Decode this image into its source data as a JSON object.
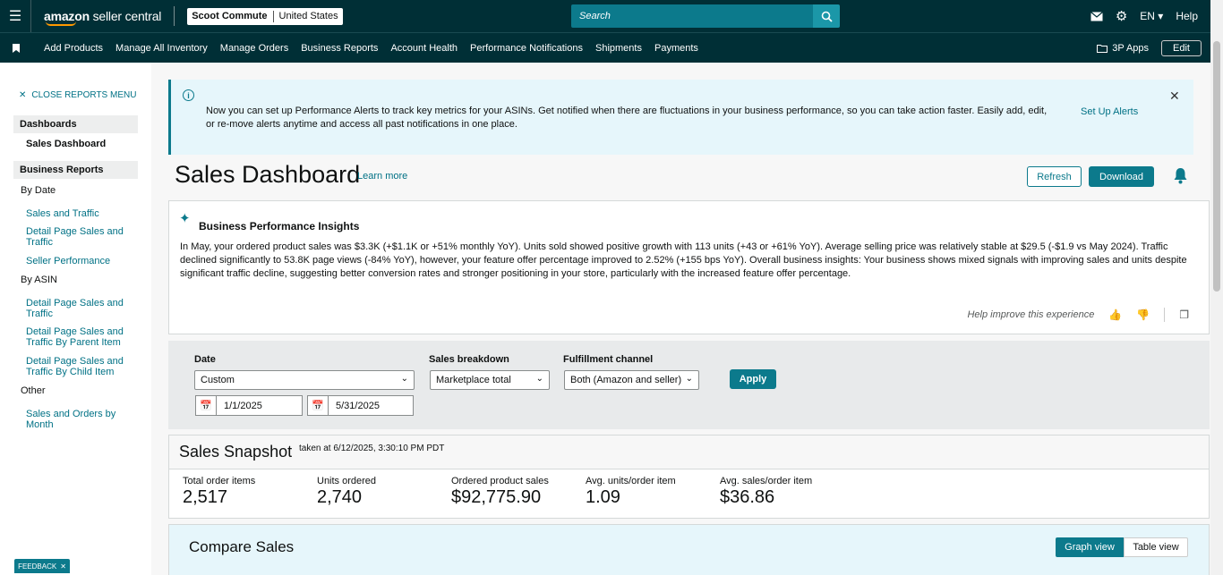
{
  "topbar": {
    "logo_bold": "amazon",
    "logo_light": " seller central",
    "store_name": "Scoot Commute",
    "marketplace": "United States",
    "search_placeholder": "Search",
    "language": "EN",
    "help": "Help"
  },
  "navbar": {
    "items": [
      "Add Products",
      "Manage All Inventory",
      "Manage Orders",
      "Business Reports",
      "Account Health",
      "Performance Notifications",
      "Shipments",
      "Payments"
    ],
    "apps_label": "3P Apps",
    "edit_label": "Edit"
  },
  "sidebar": {
    "close_menu": "CLOSE REPORTS MENU",
    "section_dashboards": "Dashboards",
    "sales_dashboard": "Sales Dashboard",
    "section_business_reports": "Business Reports",
    "by_date": "By Date",
    "by_date_links": [
      "Sales and Traffic",
      "Detail Page Sales and Traffic",
      "Seller Performance"
    ],
    "by_asin": "By ASIN",
    "by_asin_links": [
      "Detail Page Sales and Traffic",
      "Detail Page Sales and Traffic By Parent Item",
      "Detail Page Sales and Traffic By Child Item"
    ],
    "other": "Other",
    "other_links": [
      "Sales and Orders by Month"
    ]
  },
  "alert": {
    "text": "Now you can set up Performance Alerts to track key metrics for your ASINs. Get notified when there are fluctuations in your business performance, so you can take action faster. Easily add, edit, or re-move alerts anytime and access all past notifications in one place.",
    "link": "Set Up Alerts"
  },
  "page": {
    "title": "Sales Dashboard",
    "learn_more": "Learn more",
    "refresh": "Refresh",
    "download": "Download"
  },
  "insights": {
    "title": "Business Performance Insights",
    "body": "In May, your ordered product sales was $3.3K (+$1.1K or +51% monthly YoY). Units sold showed positive growth with 113 units (+43 or +61% YoY). Average selling price was relatively stable at $29.5 (-$1.9 vs May 2024). Traffic declined significantly to 53.8K page views (-84% YoY), however, your feature offer percentage improved to 2.52% (+155 bps YoY). Overall business insights: Your business shows mixed signals with improving sales and units despite significant traffic decline, suggesting better conversion rates and stronger positioning in your store, particularly with the increased feature offer percentage.",
    "feedback_prompt": "Help improve this experience"
  },
  "filters": {
    "date_label": "Date",
    "date_value": "Custom",
    "start_date": "1/1/2025",
    "end_date": "5/31/2025",
    "breakdown_label": "Sales breakdown",
    "breakdown_value": "Marketplace total",
    "channel_label": "Fulfillment channel",
    "channel_value": "Both (Amazon and seller)",
    "apply": "Apply"
  },
  "snapshot": {
    "title": "Sales Snapshot",
    "taken": "taken at 6/12/2025, 3:30:10 PM PDT",
    "metrics": [
      {
        "label": "Total order items",
        "value": "2,517"
      },
      {
        "label": "Units ordered",
        "value": "2,740"
      },
      {
        "label": "Ordered product sales",
        "value": "$92,775.90"
      },
      {
        "label": "Avg. units/order item",
        "value": "1.09"
      },
      {
        "label": "Avg. sales/order item",
        "value": "$36.86"
      }
    ]
  },
  "compare": {
    "title": "Compare Sales",
    "graph_view": "Graph view",
    "table_view": "Table view"
  },
  "feedback_tab": "FEEDBACK",
  "colors": {
    "topbar_bg": "#002f36",
    "accent_teal": "#0c7a8c",
    "link": "#007185",
    "alert_bg": "#e6f6fb"
  }
}
